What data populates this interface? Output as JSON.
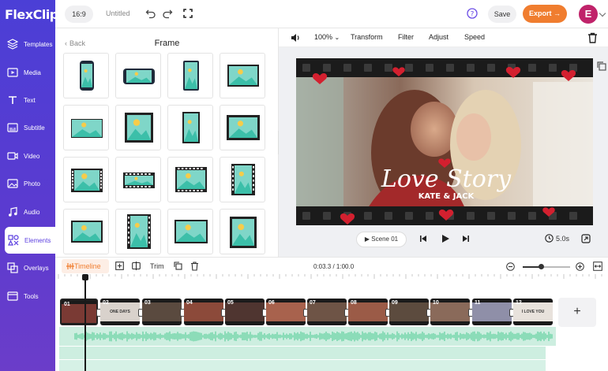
{
  "app": {
    "logo": "FlexClip"
  },
  "sidebar": {
    "items": [
      {
        "label": "Templates",
        "icon": "layers-icon"
      },
      {
        "label": "Media",
        "icon": "media-icon"
      },
      {
        "label": "Text",
        "icon": "text-icon"
      },
      {
        "label": "Subtitle",
        "icon": "subtitle-icon"
      },
      {
        "label": "Video",
        "icon": "video-icon"
      },
      {
        "label": "Photo",
        "icon": "photo-icon"
      },
      {
        "label": "Audio",
        "icon": "audio-icon"
      },
      {
        "label": "Elements",
        "icon": "elements-icon",
        "active": true
      },
      {
        "label": "Overlays",
        "icon": "overlays-icon"
      },
      {
        "label": "Tools",
        "icon": "tools-icon"
      }
    ]
  },
  "topbar": {
    "ratio": "16:9",
    "project_name": "Untitled",
    "save_label": "Save",
    "export_label": "Export",
    "avatar_initial": "E"
  },
  "panel": {
    "back_label": "Back",
    "title": "Frame",
    "frames_count": 16
  },
  "preview_toolbar": {
    "zoom": "100%",
    "tools": [
      "Transform",
      "Filter",
      "Adjust",
      "Speed"
    ]
  },
  "video": {
    "title_text": "Love Story",
    "subtitle_text": "KATE & JACK"
  },
  "playback": {
    "scene_label": "Scene 01",
    "duration": "5.0s"
  },
  "timeline_toolbar": {
    "timeline_label": "Timeline",
    "trim_label": "Trim",
    "timecode": "0:03.3 / 1:00.0",
    "zoom_level": 0.38
  },
  "timeline": {
    "clips": [
      "01",
      "02",
      "03",
      "04",
      "05",
      "06",
      "07",
      "08",
      "09",
      "10",
      "11",
      "12"
    ],
    "clip_captions": {
      "02": "ONE DAYS",
      "12": "I LOVE YOU"
    },
    "add_label": "+"
  },
  "colors": {
    "accent": "#5b3fe0",
    "export": "#f07d2f",
    "avatar": "#c0236a",
    "audio": "#6fd4a8"
  }
}
